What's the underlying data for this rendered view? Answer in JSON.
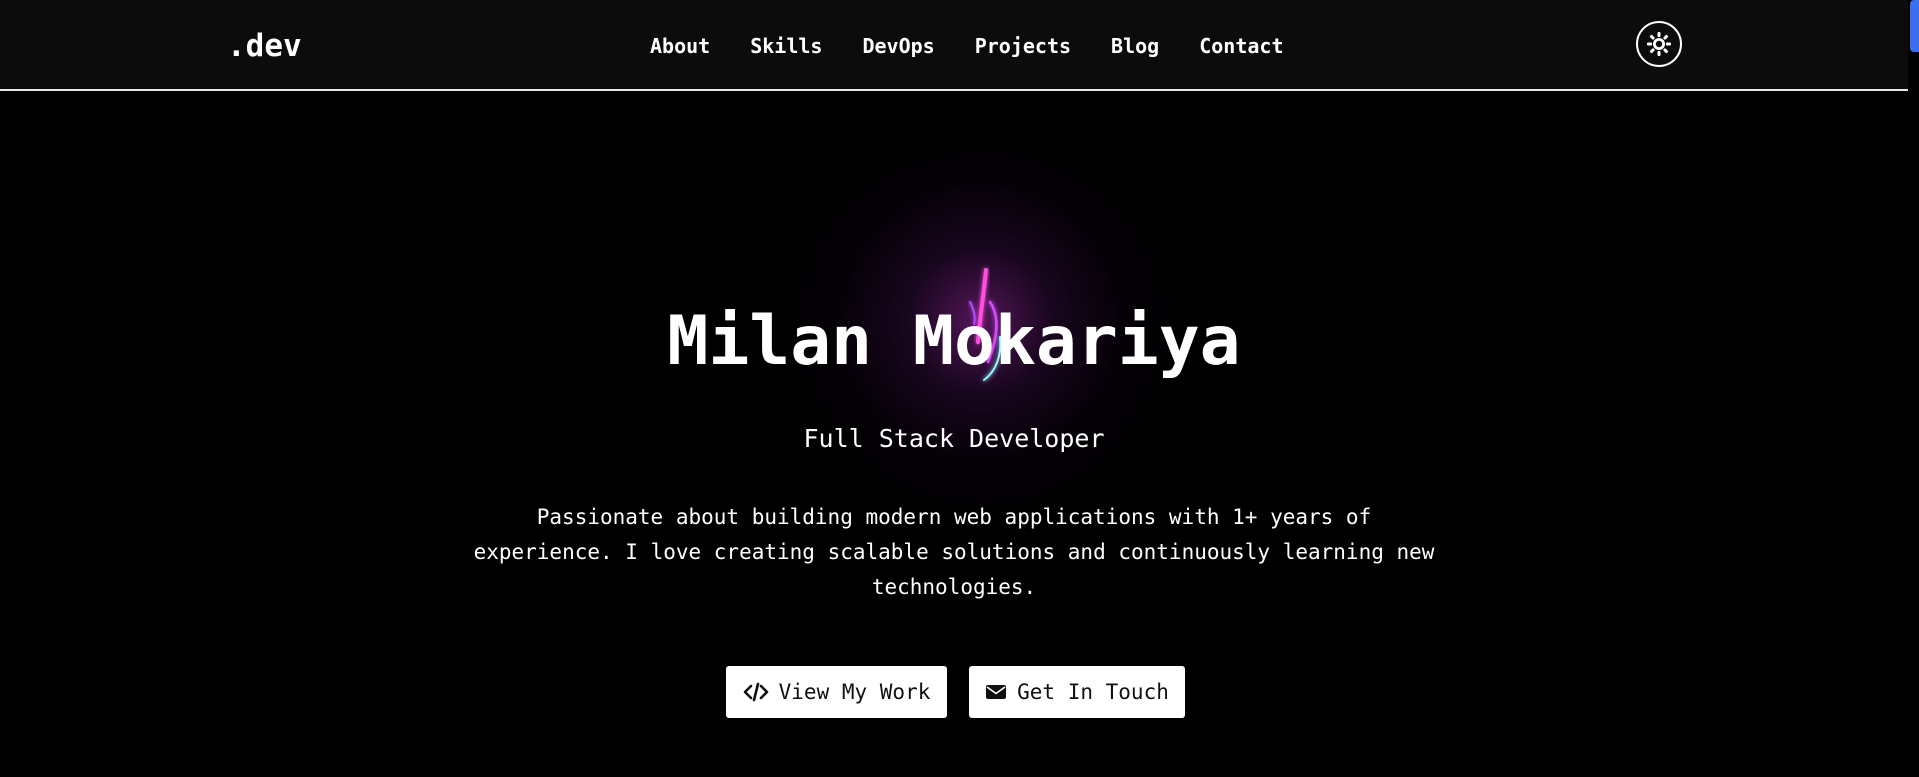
{
  "navbar": {
    "brand": ".dev",
    "links": [
      {
        "label": "About"
      },
      {
        "label": "Skills"
      },
      {
        "label": "DevOps"
      },
      {
        "label": "Projects"
      },
      {
        "label": "Blog"
      },
      {
        "label": "Contact"
      }
    ],
    "theme_toggle_icon": "sun-icon"
  },
  "hero": {
    "name": "Milan Mokariya",
    "role": "Full Stack Developer",
    "description": "Passionate about building modern web applications with 1+ years of experience. I love creating scalable solutions and continuously learning new technologies.",
    "buttons": [
      {
        "label": "View My Work",
        "icon": "code-icon"
      },
      {
        "label": "Get In Touch",
        "icon": "envelope-icon"
      }
    ]
  },
  "colors": {
    "background": "#000000",
    "navbar_background": "#0c0c0c",
    "accent_glow": "#c02adf",
    "scrollbar": "#3a6df0"
  }
}
